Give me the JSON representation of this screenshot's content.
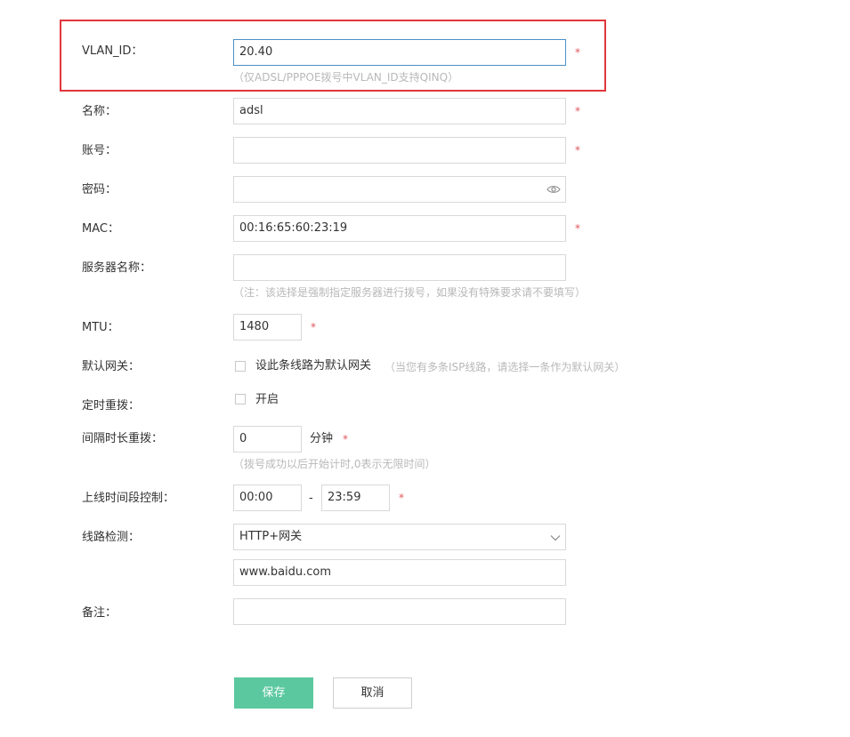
{
  "fields": {
    "vlan": {
      "label": "VLAN_ID：",
      "value": "20.40",
      "required": "*",
      "hint": "（仅ADSL/PPPOE拨号中VLAN_ID支持QINQ）"
    },
    "name": {
      "label": "名称：",
      "value": "adsl",
      "required": "*"
    },
    "account": {
      "label": "账号：",
      "value": "",
      "required": "*"
    },
    "password": {
      "label": "密码：",
      "value": "",
      "icon": "eye-icon"
    },
    "mac": {
      "label": "MAC：",
      "value": "00:16:65:60:23:19",
      "required": "*"
    },
    "server_name": {
      "label": "服务器名称：",
      "value": "",
      "hint": "（注：该选择是强制指定服务器进行拨号，如果没有特殊要求请不要填写）"
    },
    "mtu": {
      "label": "MTU：",
      "value": "1480",
      "required": "*"
    },
    "default_gateway": {
      "label": "默认网关：",
      "checkbox_label": "设此条线路为默认网关",
      "checked": false,
      "hint": "（当您有多条ISP线路，请选择一条作为默认网关）"
    },
    "timed_redial": {
      "label": "定时重拨：",
      "checkbox_label": "开启",
      "checked": false
    },
    "interval_redial": {
      "label": "间隔时长重拨：",
      "value": "0",
      "unit": "分钟",
      "required": "*",
      "hint": "（拨号成功以后开始计时,0表示无限时间）"
    },
    "online_time": {
      "label": "上线时间段控制：",
      "start": "00:00",
      "separator": "-",
      "end": "23:59",
      "required": "*"
    },
    "line_detect": {
      "label": "线路检测：",
      "selected": "HTTP+网关",
      "address": "www.baidu.com",
      "icon": "chevron-down-icon"
    },
    "remark": {
      "label": "备注：",
      "value": ""
    }
  },
  "buttons": {
    "save": "保存",
    "cancel": "取消"
  },
  "colors": {
    "accent": "#5bc8a0",
    "required": "#e0565b",
    "highlight": "#e0363b",
    "focus_border": "#4a90c8"
  }
}
